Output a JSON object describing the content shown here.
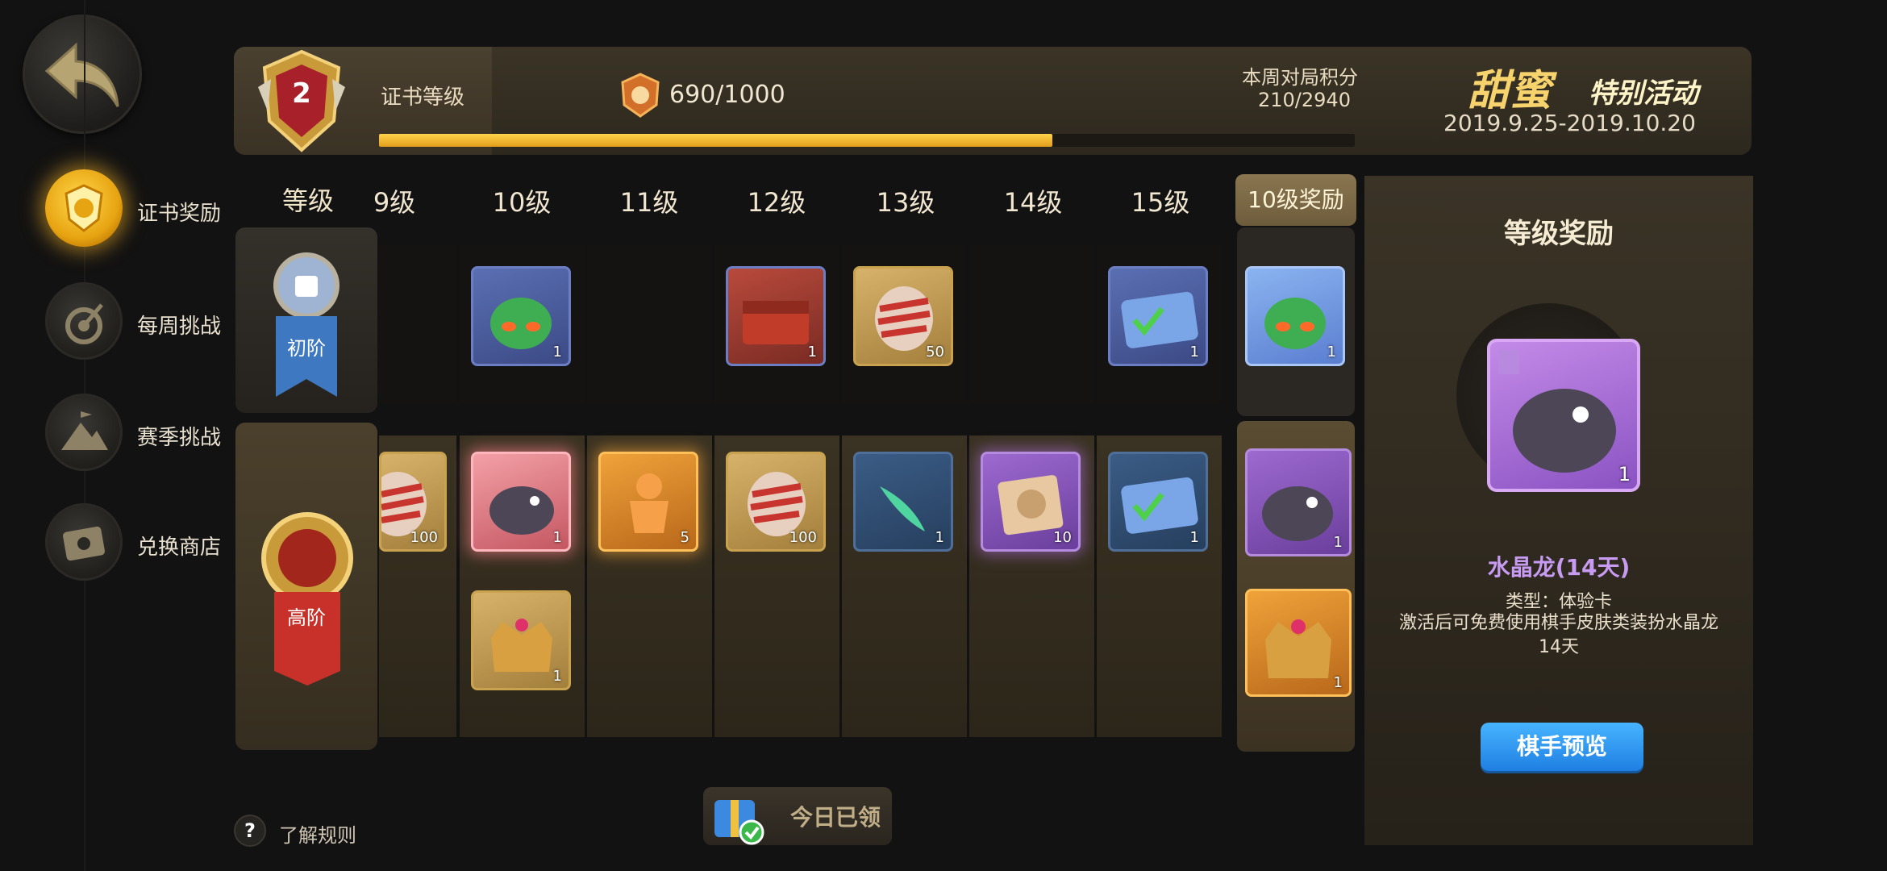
{
  "sidebar": {
    "items": [
      {
        "label": "证书奖励",
        "icon": "certificate-shield-icon",
        "active": true
      },
      {
        "label": "每周挑战",
        "icon": "target-icon",
        "active": false
      },
      {
        "label": "赛季挑战",
        "icon": "mountain-flag-icon",
        "active": false
      },
      {
        "label": "兑换商店",
        "icon": "ticket-icon",
        "active": false
      }
    ]
  },
  "header": {
    "level_badge": "2",
    "cert_label": "证书等级",
    "points": "690/1000",
    "progress_fraction": 0.69,
    "weekly_label": "本周对局积分",
    "weekly_value": "210/2940",
    "event_title": "甜蜜",
    "event_subtitle": "特别活动",
    "event_dates": "2019.9.25-2019.10.20"
  },
  "grid": {
    "level_header": "等级",
    "columns": [
      "9级",
      "10级",
      "11级",
      "12级",
      "13级",
      "14级",
      "15级"
    ],
    "reward_column_header": "10级奖励",
    "tier_basic": "初阶",
    "tier_advanced": "高阶",
    "basic_items": [
      {
        "col": 1,
        "count": "1",
        "kind": "goblin-avatar",
        "color": "blue"
      },
      {
        "col": 3,
        "count": "1",
        "kind": "treasure-chest",
        "color": "blue"
      },
      {
        "col": 4,
        "count": "50",
        "kind": "candy",
        "color": "gold"
      },
      {
        "col": 6,
        "count": "1",
        "kind": "ticket-card",
        "color": "blue"
      }
    ],
    "advanced_items": [
      {
        "col": 0,
        "count": "100",
        "kind": "candy",
        "color": "gold"
      },
      {
        "col": 1,
        "count": "1",
        "kind": "dragon-skin",
        "color": "pink"
      },
      {
        "col": 2,
        "count": "5",
        "kind": "gingerbread",
        "color": "orange"
      },
      {
        "col": 3,
        "count": "100",
        "kind": "candy",
        "color": "gold"
      },
      {
        "col": 4,
        "count": "1",
        "kind": "fish-effect",
        "color": "teal"
      },
      {
        "col": 5,
        "count": "10",
        "kind": "lion-card",
        "color": "purple"
      },
      {
        "col": 6,
        "count": "1",
        "kind": "ticket-card",
        "color": "teal"
      }
    ],
    "advanced_items_row2": [
      {
        "col": 1,
        "count": "1",
        "kind": "crown-chest",
        "color": "gold"
      }
    ],
    "reward_basic": {
      "count": "1",
      "kind": "goblin-avatar",
      "color": "lightblue"
    },
    "reward_advanced": [
      {
        "count": "1",
        "kind": "dragon-skin",
        "color": "purple"
      },
      {
        "count": "1",
        "kind": "crown-chest",
        "color": "orange"
      }
    ]
  },
  "panel": {
    "title": "等级奖励",
    "item_count": "1",
    "item_name": "水晶龙(14天)",
    "item_type": "类型：体验卡",
    "item_desc": "激活后可免费使用棋手皮肤类装扮水晶龙14天",
    "preview_button": "棋手预览"
  },
  "footer": {
    "rules_icon": "?",
    "rules_label": "了解规则",
    "claim_label": "今日已领"
  },
  "colors": {
    "accent_gold": "#f2b830",
    "progress": "#e9a52a",
    "preview_button": "#2a8ff0",
    "item_name": "#c79bf2"
  }
}
